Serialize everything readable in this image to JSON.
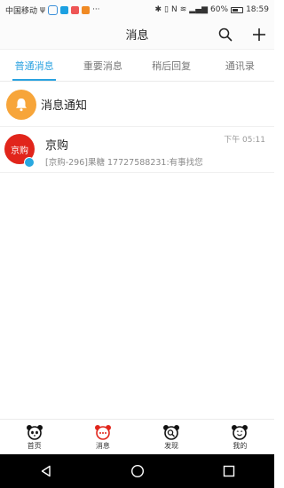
{
  "status_bar": {
    "carrier": "中国移动",
    "battery": "60%",
    "time": "18:59"
  },
  "header": {
    "title": "消息",
    "actions": [
      {
        "icon": "search-icon"
      },
      {
        "icon": "plus-icon"
      }
    ]
  },
  "tabs": [
    {
      "label": "普通消息",
      "active": true
    },
    {
      "label": "重要消息",
      "active": false
    },
    {
      "label": "稍后回复",
      "active": false
    },
    {
      "label": "通讯录",
      "active": false
    }
  ],
  "notification_row": {
    "label": "消息通知",
    "icon": "bell-icon",
    "color": "#f7a53a"
  },
  "messages": [
    {
      "avatar_text": "京购",
      "name": "京购",
      "time": "下午 05:11",
      "preview": "[京购-296]果糖  17727588231:有事找您",
      "avatar_color": "#e1251b"
    }
  ],
  "bottom_nav": [
    {
      "label": "首页",
      "icon": "panda-home-icon"
    },
    {
      "label": "消息",
      "icon": "panda-message-icon",
      "active": true
    },
    {
      "label": "发现",
      "icon": "panda-discover-icon"
    },
    {
      "label": "我的",
      "icon": "panda-profile-icon"
    }
  ],
  "colors": {
    "accent": "#2aa2e0",
    "bell": "#f7a53a",
    "brand_red": "#e1251b"
  }
}
